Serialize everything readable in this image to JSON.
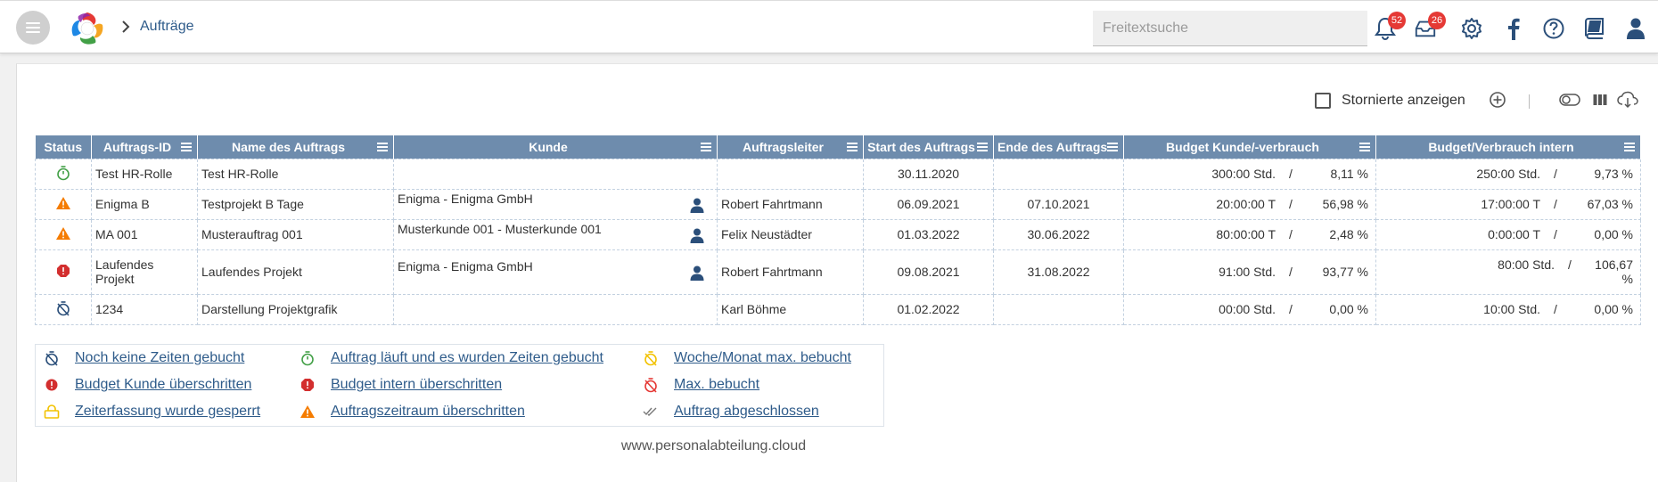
{
  "header": {
    "breadcrumb": "Aufträge",
    "search_placeholder": "Freitextsuche",
    "notifications_count": "52",
    "inbox_count": "26"
  },
  "toolbar": {
    "show_cancelled_label": "Stornierte anzeigen"
  },
  "table": {
    "columns": [
      "Status",
      "Auftrags-ID",
      "Name des Auftrags",
      "Kunde",
      "Auftragsleiter",
      "Start des Auftrags",
      "Ende des Auftrags",
      "Budget Kunde/-verbrauch",
      "Budget/Verbrauch intern"
    ],
    "rows": [
      {
        "status": "running",
        "id": "Test HR-Rolle",
        "name": "Test HR-Rolle",
        "customer": "",
        "lead": "",
        "start": "30.11.2020",
        "end": "",
        "budget_customer": "300:00 Std.",
        "sep1": "/",
        "usage_customer": "8,11 %",
        "budget_internal": "250:00 Std.",
        "sep2": "/",
        "usage_internal": "9,73 %"
      },
      {
        "status": "period-exceeded",
        "id": "Enigma B",
        "name": "Testprojekt B Tage",
        "customer": "Enigma - Enigma GmbH",
        "lead": "Robert Fahrtmann",
        "start": "06.09.2021",
        "end": "07.10.2021",
        "budget_customer": "20:00:00 T",
        "sep1": "/",
        "usage_customer": "56,98 %",
        "budget_internal": "17:00:00 T",
        "sep2": "/",
        "usage_internal": "67,03 %"
      },
      {
        "status": "period-exceeded",
        "id": "MA 001",
        "name": "Musterauftrag 001",
        "customer": "Musterkunde 001 - Musterkunde 001",
        "lead": "Felix Neustädter",
        "start": "01.03.2022",
        "end": "30.06.2022",
        "budget_customer": "80:00:00 T",
        "sep1": "/",
        "usage_customer": "2,48 %",
        "budget_internal": "0:00:00 T",
        "sep2": "/",
        "usage_internal": "0,00 %"
      },
      {
        "status": "budget-internal-exceeded",
        "id": "Laufendes Projekt",
        "name": "Laufendes Projekt",
        "customer": "Enigma - Enigma GmbH",
        "lead": "Robert Fahrtmann",
        "start": "09.08.2021",
        "end": "31.08.2022",
        "budget_customer": "91:00 Std.",
        "sep1": "/",
        "usage_customer": "93,77 %",
        "budget_internal": "80:00 Std.",
        "sep2": "/",
        "usage_internal": "106,67 %"
      },
      {
        "status": "no-times",
        "id": "1234",
        "name": "Darstellung Projektgrafik",
        "customer": "",
        "lead": "Karl Böhme",
        "start": "01.02.2022",
        "end": "",
        "budget_customer": "00:00 Std.",
        "sep1": "/",
        "usage_customer": "0,00 %",
        "budget_internal": "10:00 Std.",
        "sep2": "/",
        "usage_internal": "0,00 %"
      }
    ]
  },
  "legend": [
    {
      "icon": "timer-off-blue-icon",
      "label": "Noch keine Zeiten gebucht"
    },
    {
      "icon": "timer-green-icon",
      "label": "Auftrag läuft und es wurden Zeiten gebucht"
    },
    {
      "icon": "timer-off-yellow-icon",
      "label": "Woche/Monat max. bebucht"
    },
    {
      "icon": "alert-circle-red-icon",
      "label": "Budget Kunde überschritten"
    },
    {
      "icon": "alert-octagon-red-icon",
      "label": "Budget intern überschritten"
    },
    {
      "icon": "timer-off-red-icon",
      "label": "Max. bebucht"
    },
    {
      "icon": "lock-yellow-icon",
      "label": "Zeiterfassung wurde gesperrt"
    },
    {
      "icon": "warning-orange-icon",
      "label": "Auftragszeitraum überschritten"
    },
    {
      "icon": "double-check-icon",
      "label": "Auftrag abgeschlossen"
    }
  ],
  "footer": {
    "url": "www.personalabteilung.cloud"
  },
  "colors": {
    "header_bg": "#6e8cad",
    "link": "#2e5b8a",
    "icon_blue": "#2b4f7a",
    "badge_red": "#e53935"
  }
}
